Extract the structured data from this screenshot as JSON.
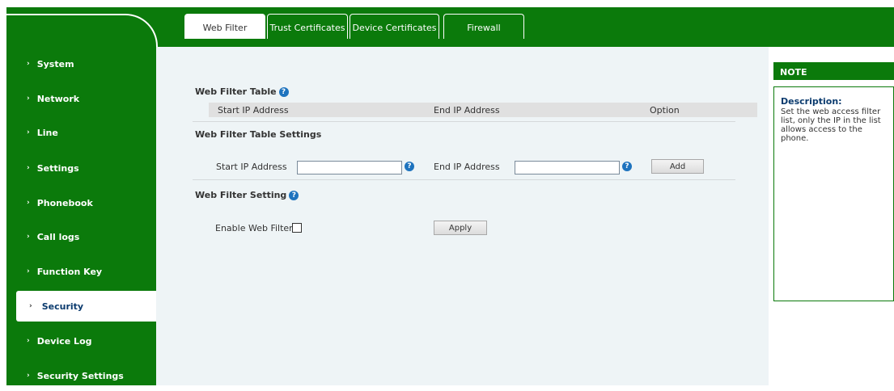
{
  "tabs": [
    {
      "label": "Web Filter",
      "active": true
    },
    {
      "label": "Trust Certificates",
      "active": false
    },
    {
      "label": "Device Certificates",
      "active": false
    },
    {
      "label": "Firewall",
      "active": false
    }
  ],
  "sidebar": {
    "items": [
      {
        "label": "System"
      },
      {
        "label": "Network"
      },
      {
        "label": "Line"
      },
      {
        "label": "Settings"
      },
      {
        "label": "Phonebook"
      },
      {
        "label": "Call logs"
      },
      {
        "label": "Function Key"
      },
      {
        "label": "Security",
        "active": true
      },
      {
        "label": "Device Log"
      },
      {
        "label": "Security Settings"
      }
    ]
  },
  "main": {
    "web_filter_table": {
      "title": "Web Filter Table",
      "columns": [
        "Start IP Address",
        "End IP Address",
        "Option"
      ],
      "rows": []
    },
    "table_settings": {
      "title": "Web Filter Table Settings",
      "start_label": "Start IP Address",
      "start_value": "",
      "end_label": "End IP Address",
      "end_value": "",
      "add_label": "Add"
    },
    "filter_setting": {
      "title": "Web Filter Setting",
      "enable_label": "Enable Web Filter",
      "enabled": false,
      "apply_label": "Apply"
    }
  },
  "note": {
    "header": "NOTE",
    "desc_title": "Description:",
    "desc_text": "Set the web access filter list, only the IP in the list allows access to the phone."
  },
  "colors": {
    "brand_green": "#0b7a0b",
    "content_bg": "#eef4f6",
    "help_blue": "#1e73be"
  },
  "icons": {
    "help": "question-circle-icon",
    "nav_arrow": "chevron-right-icon"
  }
}
